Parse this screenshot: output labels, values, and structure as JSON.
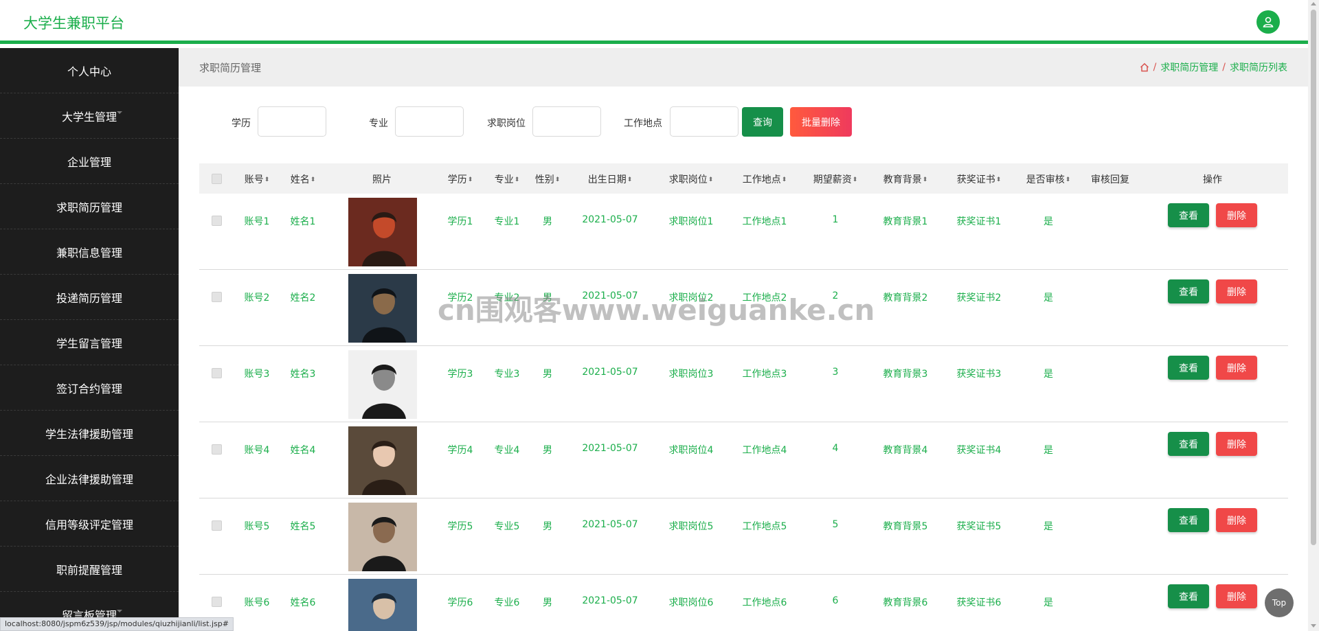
{
  "brand": "大学生兼职平台",
  "sidebar": {
    "items": [
      {
        "label": "个人中心",
        "caret": false
      },
      {
        "label": "大学生管理",
        "caret": true
      },
      {
        "label": "企业管理",
        "caret": false
      },
      {
        "label": "求职简历管理",
        "caret": false
      },
      {
        "label": "兼职信息管理",
        "caret": false
      },
      {
        "label": "投递简历管理",
        "caret": false
      },
      {
        "label": "学生留言管理",
        "caret": false
      },
      {
        "label": "签订合约管理",
        "caret": false
      },
      {
        "label": "学生法律援助管理",
        "caret": false
      },
      {
        "label": "企业法律援助管理",
        "caret": false
      },
      {
        "label": "信用等级评定管理",
        "caret": false
      },
      {
        "label": "职前提醒管理",
        "caret": false
      },
      {
        "label": "留言板管理",
        "caret": true
      }
    ]
  },
  "breadcrumb": {
    "title": "求职简历管理",
    "sep": "/",
    "items": [
      "求职简历管理",
      "求职简历列表"
    ]
  },
  "search": {
    "labels": [
      "学历",
      "专业",
      "求职岗位",
      "工作地点"
    ],
    "query_label": "查询",
    "batch_delete_label": "批量删除"
  },
  "table": {
    "headers": [
      {
        "label": "账号",
        "sortable": true
      },
      {
        "label": "姓名",
        "sortable": true
      },
      {
        "label": "照片",
        "sortable": false
      },
      {
        "label": "学历",
        "sortable": true
      },
      {
        "label": "专业",
        "sortable": true
      },
      {
        "label": "性别",
        "sortable": true
      },
      {
        "label": "出生日期",
        "sortable": true
      },
      {
        "label": "求职岗位",
        "sortable": true
      },
      {
        "label": "工作地点",
        "sortable": true
      },
      {
        "label": "期望薪资",
        "sortable": true
      },
      {
        "label": "教育背景",
        "sortable": true
      },
      {
        "label": "获奖证书",
        "sortable": true
      },
      {
        "label": "是否审核",
        "sortable": true
      },
      {
        "label": "审核回复",
        "sortable": false
      },
      {
        "label": "操作",
        "sortable": false
      }
    ],
    "rows": [
      {
        "account": "账号1",
        "name": "姓名1",
        "education": "学历1",
        "major": "专业1",
        "gender": "男",
        "birth": "2021-05-07",
        "position": "求职岗位1",
        "location": "工作地点1",
        "salary": "1",
        "background": "教育背景1",
        "award": "获奖证书1",
        "reviewed": "是",
        "reply": "",
        "photo_colors": [
          "#6b2a1f",
          "#c44a2a",
          "#2a1a14"
        ]
      },
      {
        "account": "账号2",
        "name": "姓名2",
        "education": "学历2",
        "major": "专业2",
        "gender": "男",
        "birth": "2021-05-07",
        "position": "求职岗位2",
        "location": "工作地点2",
        "salary": "2",
        "background": "教育背景2",
        "award": "获奖证书2",
        "reviewed": "是",
        "reply": "",
        "photo_colors": [
          "#2b3a48",
          "#8a6a4a",
          "#101418"
        ]
      },
      {
        "account": "账号3",
        "name": "姓名3",
        "education": "学历3",
        "major": "专业3",
        "gender": "男",
        "birth": "2021-05-07",
        "position": "求职岗位3",
        "location": "工作地点3",
        "salary": "3",
        "background": "教育背景3",
        "award": "获奖证书3",
        "reviewed": "是",
        "reply": "",
        "photo_colors": [
          "#f0f0f0",
          "#8a8a8a",
          "#1a1a1a"
        ]
      },
      {
        "account": "账号4",
        "name": "姓名4",
        "education": "学历4",
        "major": "专业4",
        "gender": "男",
        "birth": "2021-05-07",
        "position": "求职岗位4",
        "location": "工作地点4",
        "salary": "4",
        "background": "教育背景4",
        "award": "获奖证书4",
        "reviewed": "是",
        "reply": "",
        "photo_colors": [
          "#5a4a3a",
          "#e8c8b0",
          "#2a1e16"
        ]
      },
      {
        "account": "账号5",
        "name": "姓名5",
        "education": "学历5",
        "major": "专业5",
        "gender": "男",
        "birth": "2021-05-07",
        "position": "求职岗位5",
        "location": "工作地点5",
        "salary": "5",
        "background": "教育背景5",
        "award": "获奖证书5",
        "reviewed": "是",
        "reply": "",
        "photo_colors": [
          "#c8b8a8",
          "#8a6a50",
          "#1a1a1a"
        ]
      },
      {
        "account": "账号6",
        "name": "姓名6",
        "education": "学历6",
        "major": "专业6",
        "gender": "男",
        "birth": "2021-05-07",
        "position": "求职岗位6",
        "location": "工作地点6",
        "salary": "6",
        "background": "教育背景6",
        "award": "获奖证书6",
        "reviewed": "是",
        "reply": "",
        "photo_colors": [
          "#4a6a8a",
          "#d8c0a8",
          "#1a2a3a"
        ]
      }
    ],
    "view_label": "查看",
    "delete_label": "删除"
  },
  "watermark": "cn围观客www.weiguanke.cn",
  "top_button": "Top",
  "status_url": "localhost:8080/jspm6z539/jsp/modules/qiuzhijianli/list.jsp#",
  "colors": {
    "accent": "#1bae4b",
    "danger": "#f04848",
    "sidebar_bg": "#1d1d1d"
  }
}
